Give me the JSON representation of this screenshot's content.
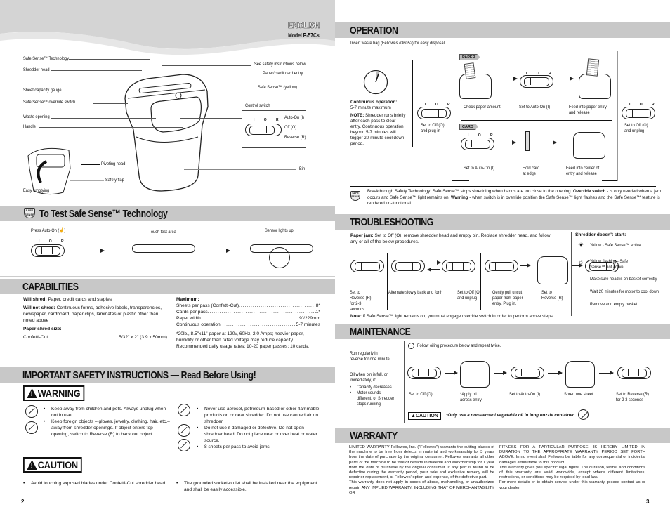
{
  "left_page": {
    "language": "ENGLISH",
    "model": "Model P-57Cs",
    "page_number": "2",
    "diagram_labels": {
      "safe_sense_technology": "Safe Sense™ Technology",
      "shredder_head": "Shredder head",
      "sheet_capacity_gauge": "Sheet capacity gauge",
      "override_switch": "Safe Sense™ override switch",
      "waste_opening": "Waste opening",
      "handle": "Handle",
      "pivoting_head": "Pivoting head",
      "safety_flap": "Safety flap",
      "easy_emptying": "Easy emptying",
      "see_safety": "See safety instructions below",
      "paper_card_entry": "Paper/credit card entry",
      "safe_sense_yellow": "Safe Sense™ (yellow)",
      "control_switch": "Control switch",
      "auto_on": "Auto-On (I)",
      "off": "Off (O)",
      "reverse": "Reverse (R)",
      "bin": "Bin",
      "ior": "I O R"
    },
    "test_section": {
      "title": "To Test Safe Sense™ Technology",
      "steps": [
        "Press Auto-On (☝)",
        "Touch test area",
        "Sensor lights up"
      ]
    },
    "capabilities": {
      "title": "CAPABILITIES",
      "will_shred_label": "Will shred:",
      "will_shred": "Paper, credit cards and staples",
      "will_not_shred_label": "Will not shred:",
      "will_not_shred": "Continuous forms, adhesive labels, transparencies, newspaper, cardboard, paper clips, laminates or plastic other than noted above",
      "shred_size_label": "Paper shred size:",
      "shred_size_name": "Confetti-Cut",
      "shred_size_value": "5/32\" x 2\" (3.9 x 50mm)",
      "maximum_label": "Maximum:",
      "maximum": [
        {
          "label": "Sheets per pass (Confetti-Cut)",
          "value": "8*"
        },
        {
          "label": "Cards per pass",
          "value": "1*"
        },
        {
          "label": "Paper width",
          "value": "9\"/229mm"
        },
        {
          "label": "Continuous operation",
          "value": "5-7 minutes"
        }
      ],
      "footnote": "*20lb., 8.5\"x11\" paper at 120v, 60Hz, 2.0 Amps; heavier paper, humidity or other than rated voltage may reduce capacity. Recommended daily usage rates: 10-20 paper passes; 10 cards."
    },
    "safety": {
      "title": "IMPORTANT SAFETY INSTRUCTIONS — Read Before Using!",
      "warning_label": "WARNING",
      "warning_left": [
        "Keep away from children and pets. Always unplug when not in use.",
        "Keep foreign objects – gloves, jewelry, clothing, hair, etc.– away from shredder openings. If object enters top opening, switch to Reverse (R) to back out object."
      ],
      "warning_right": [
        "Never use aerosol, petroleum-based or other flammable products on or near shredder. Do not use canned air on shredder.",
        "Do not use if damaged or defective. Do not open shredder head. Do not place near or over heat or water source.",
        "8 sheets per pass to avoid jams."
      ],
      "caution_label": "CAUTION",
      "caution_left": "Avoid touching exposed blades under Confetti-Cut shredder head.",
      "caution_right": "The grounded socket-outlet shall be installed near the equipment and shall be easily accessible."
    }
  },
  "right_page": {
    "page_number": "3",
    "operation": {
      "title": "OPERATION",
      "intro": "Insert waste bag (Fellowes #36052) for easy disposal.",
      "continuous_label": "Continuous operation:",
      "continuous_value": "5-7 minute maximum",
      "note_label": "NOTE:",
      "note": "Shredder runs briefly after each pass to clear entry. Continuous operation beyond 5-7 minutes will trigger 20-minute cool down period.",
      "start_step": "Set to Off (O) and plug in",
      "end_step": "Set to Off (O) and unplug",
      "paper_tag": "PAPER",
      "paper_steps": [
        "Check paper amount",
        "Set to Auto-On (I)",
        "Feed into paper entry and release"
      ],
      "card_tag": "CARD",
      "card_steps": [
        "Set to Auto-On (I)",
        "Hold card at edge",
        "Feed into center of entry and release"
      ],
      "safe_sense_note_1": "Breakthrough Safety Technology! Safe Sense™ stops shredding when hands are too close to the opening.",
      "override_label": "Override switch",
      "safe_sense_note_2": "- is only needed when a jam occurs and Safe Sense™ light remains on.",
      "warning_word": "Warning",
      "safe_sense_note_3": "- when switch is in override position the Safe Sense™ light flashes and the Safe Sense™ feature is rendered un-functional."
    },
    "troubleshooting": {
      "title": "TROUBLESHOOTING",
      "paper_jam_label": "Paper jam:",
      "paper_jam": "Set to Off (O), remove shredder head and empty bin. Replace shredder head, and follow any or all of the below procedures.",
      "steps": [
        "Set to Reverse (R) for 2-3 seconds",
        "Alternate slowly back and forth",
        "Set to Off (O) and unplug",
        "Gently pull uncut paper from paper entry. Plug in.",
        "Set to Reverse (R)"
      ],
      "note_label": "Note:",
      "note": "If Safe Sense™ light remains on, you must engage override switch in order to perform above steps.",
      "doesnt_start_label": "Shredder doesn't start:",
      "doesnt_start": [
        "Yellow - Safe Sense™ active",
        "Yellow flashing - Safe Sense™ not active",
        "Make sure head is on basket correctly",
        "Wait 20 minutes for motor to cool down",
        "Remove and empty basket"
      ]
    },
    "maintenance": {
      "title": "MAINTENANCE",
      "run_reverse": "Run regularly in reverse for one minute",
      "oil_when": "Oil when bin is full, or immediately, if:",
      "oil_bullets": [
        "Capacity decreases",
        "Motor sounds different, or Shredder stops running"
      ],
      "follow": "Follow oiling procedure below and repeat twice.",
      "steps": [
        "Set to Off (O)",
        "*Apply oil across entry",
        "Set to Auto-On (I)",
        "Shred one sheet",
        "Set to Reverse (R) for 2-3 seconds"
      ],
      "caution_label": "CAUTION",
      "caution_note": "*Only use a non-aerosol vegetable oil in long nozzle container"
    },
    "warranty": {
      "title": "WARRANTY",
      "col1": "LIMITED WARRANTY Fellowes, Inc. (\"Fellowes\") warrants the cutting blades of the machine to be free from defects in material and workmanship for 3 years from the date of purchase by the original consumer. Fellowes warrants all other parts of the machine to be free of defects in material and workmanship for 1 year from the date of purchase by the original consumer. If any part is found to be defective during the warranty period, your sole and exclusive remedy will be repair or replacement, at Fellowes' option and expense, of the defective part.",
      "col1b": "This warranty does not apply in cases of abuse, mishandling, or unauthorized repair. ANY IMPLIED WARRANTY, INCLUDING THAT OF MERCHANTABILITY OR",
      "col2": "FITNESS FOR A PARTICULAR PURPOSE, IS HEREBY LIMITED IN DURATION TO THE APPROPRIATE WARRANTY PERIOD SET FORTH ABOVE. In no event shall Fellowes be liable for any consequential or incidental damages attributable to this product.",
      "col2b": "This warranty gives you specific legal rights. The duration, terms, and conditions of this warranty are valid worldwide, except where different limitations, restrictions, or conditions may be required by local law.",
      "col2c": "For more details or to obtain service under this warranty, please contact us or your dealer."
    }
  }
}
